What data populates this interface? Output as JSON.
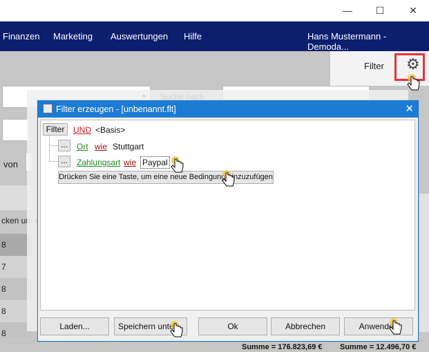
{
  "window": {
    "minimize": "—",
    "maximize": "☐",
    "close": "✕"
  },
  "menu": {
    "items": [
      "Finanzen",
      "Marketing",
      "Auswertungen",
      "Hilfe"
    ],
    "user": "Hans Mustermann - Demoda..."
  },
  "filter_panel": {
    "label": "Filter"
  },
  "background": {
    "search_label": "Suche nach",
    "von_label": "von",
    "hint_text": "cken um ei",
    "row_values": [
      "8",
      "7",
      "8",
      "8",
      "8"
    ]
  },
  "dialog": {
    "title": "Filter erzeugen - [unbenannt.flt]",
    "filter_button": "Filter",
    "root_operator": "UND",
    "root_basis": "<Basis>",
    "conditions": [
      {
        "button": "...",
        "field": "Ort",
        "operator": "wie",
        "value": "Stuttgart"
      },
      {
        "button": "...",
        "field": "Zahlungsart",
        "operator": "wie",
        "value": "Paypal"
      }
    ],
    "add_hint": "Drücken Sie eine Taste, um eine neue Bedingung hinzuzufügen",
    "buttons": {
      "load": "Laden...",
      "save_as": "Speichern unter...",
      "ok": "Ok",
      "cancel": "Abbrechen",
      "apply": "Anwenden"
    }
  },
  "sums": {
    "left": "Summe = 176.823,69 €",
    "right": "Summe = 12.496,70 €"
  },
  "colors": {
    "menubar": "#0b1f6e",
    "dialog_title": "#1c7bd3",
    "highlight_border": "#e8333a"
  }
}
